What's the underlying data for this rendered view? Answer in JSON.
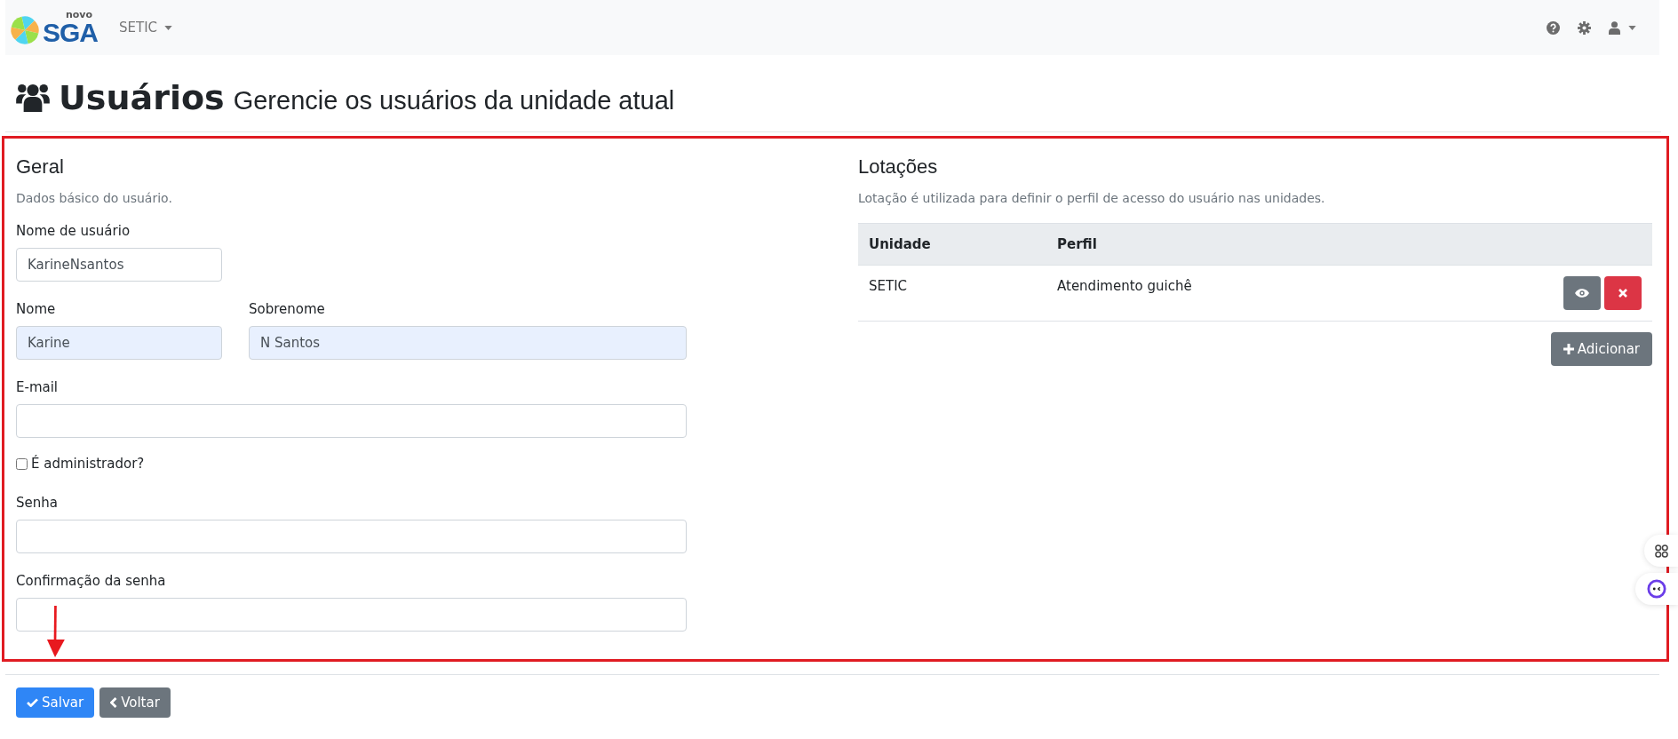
{
  "navbar": {
    "logo_small": "novo",
    "logo_text": "SGA",
    "unit_menu": "SETIC"
  },
  "header": {
    "title": "Usuários",
    "subtitle": "Gerencie os usuários da unidade atual"
  },
  "general": {
    "heading": "Geral",
    "description": "Dados básico do usuário.",
    "fields": [
      {
        "kind": "username",
        "label": "Nome de usuário",
        "value": "KarineNsantos",
        "autofilled": false
      },
      {
        "kind": "row",
        "items": [
          {
            "label": "Nome",
            "value": "Karine",
            "autofilled": true
          },
          {
            "label": "Sobrenome",
            "value": "N Santos",
            "autofilled": true
          }
        ]
      },
      {
        "kind": "email",
        "label": "E-mail",
        "autofilled": false
      },
      {
        "kind": "checkbox",
        "label": "É administrador?",
        "checked": false
      },
      {
        "kind": "password",
        "label": "Senha",
        "autofilled": false
      },
      {
        "kind": "password",
        "label": "Confirmação da senha",
        "autofilled": false
      }
    ]
  },
  "assignments": {
    "heading": "Lotações",
    "description": "Lotação é utilizada para definir o perfil de acesso do usuário nas unidades.",
    "columns": [
      "Unidade",
      "Perfil"
    ],
    "rows": [
      {
        "unit": "SETIC",
        "profile": "Atendimento guichê"
      }
    ],
    "add_button": "Adicionar"
  },
  "actions": [
    {
      "kind": "primary",
      "label": "Salvar"
    },
    {
      "kind": "secondary",
      "label": "Voltar"
    }
  ]
}
